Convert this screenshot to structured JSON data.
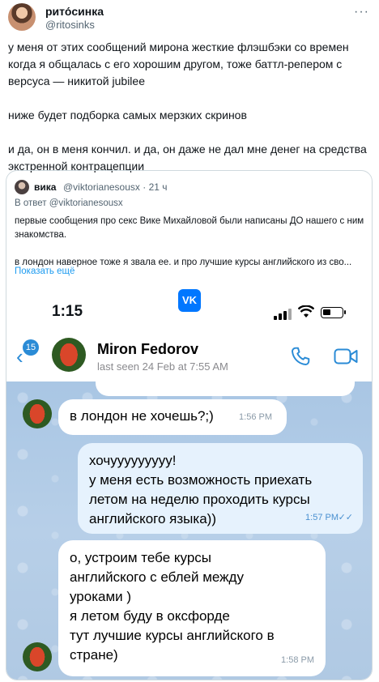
{
  "author": {
    "name": "рито́синка",
    "handle": "@ritosinks"
  },
  "tweet": {
    "paragraphs": [
      "у меня от этих сообщений мирона жесткие флэшбэки со времен когда я общалась с его хорошим другом, тоже баттл-репером с версуса — никитой jubilee",
      "ниже будет подборка самых мерзких скринов",
      "и да, он в меня кончил. и да, он даже не дал мне денег на средства экстренной контрацепции"
    ]
  },
  "quoted": {
    "name": "вика",
    "handle": "@viktorianesousx",
    "time": "· 21 ч",
    "reply_to": "В ответ @viktorianesousx",
    "lines": [
      "первые сообщения про секс Вике Михайловой были написаны ДО нашего с ним знакомства.",
      "в лондон наверное тоже я звала ее. и про лучшие курсы английского из сво..."
    ],
    "show_more": "Показать ещё"
  },
  "phone": {
    "status_time": "1:15",
    "vk_label": "VK",
    "unread_count": "15",
    "contact_name": "Miron Fedorov",
    "last_seen": "last seen 24 Feb at 7:55 AM"
  },
  "messages": [
    {
      "direction": "in",
      "text": "в лондон не хочешь?;)",
      "time": "1:56 PM"
    },
    {
      "direction": "out",
      "text": "хочууууууууу!\nу меня есть возможность приехать\nлетом на неделю проходить курсы\nанглийского языка))",
      "time": "1:57 PM",
      "read": "✓✓"
    },
    {
      "direction": "in",
      "text": "о, устроим тебе курсы\nанглийского с еблей между\nуроками )\nя летом буду в оксфорде\nтут лучшие курсы английского в\nстране)",
      "time": "1:58 PM"
    }
  ],
  "icons": {
    "more": "more-icon",
    "back": "chevron-left-icon",
    "call": "phone-icon",
    "video": "video-icon"
  },
  "colors": {
    "accent_blue": "#1d9bf0",
    "vk_blue": "#0077ff",
    "ios_blue": "#2a8bd6"
  }
}
